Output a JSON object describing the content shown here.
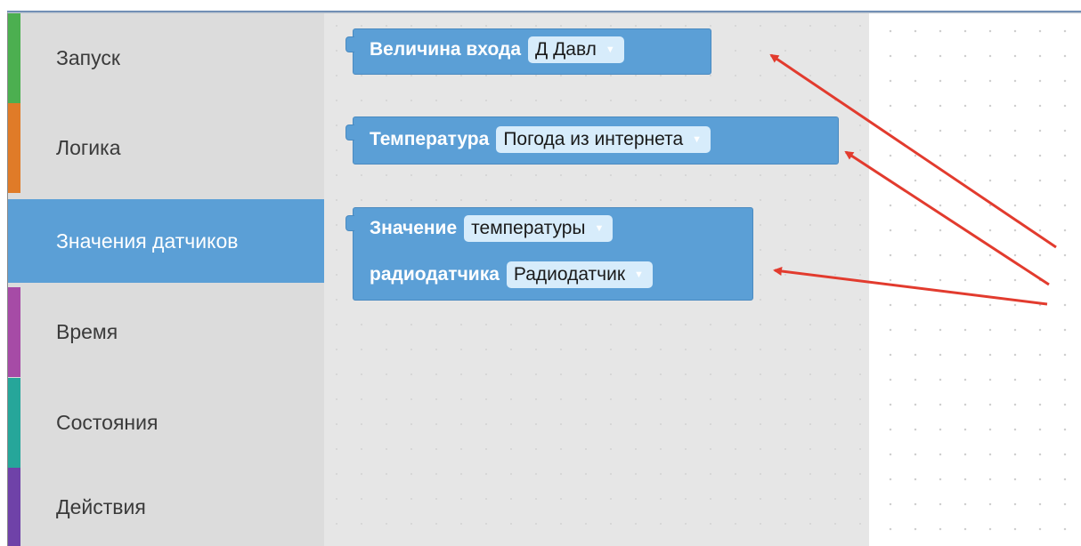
{
  "categories": [
    {
      "label": "Запуск",
      "color": "#4caf50"
    },
    {
      "label": "Логика",
      "color": "#e07b28"
    },
    {
      "label": "Значения датчиков",
      "color": "#5b9fd6",
      "selected": true
    },
    {
      "label": "Время",
      "color": "#a64ba6"
    },
    {
      "label": "Состояния",
      "color": "#26a69a"
    },
    {
      "label": "Действия",
      "color": "#6f42a8"
    }
  ],
  "blocks": [
    {
      "text": "Величина входа",
      "dropdown": "Д Давл"
    },
    {
      "text": "Температура",
      "dropdown": "Погода из интернета"
    },
    {
      "text1": "Значение",
      "dropdown1": "температуры",
      "text2": "радиодатчика",
      "dropdown2": "Радиодатчик"
    }
  ],
  "colors": {
    "block": "#5b9fd6",
    "arrow": "#e23b2e",
    "dropdown": "#d7ecfb"
  },
  "icons": {
    "dropdown": "dropdown-arrow-icon"
  }
}
